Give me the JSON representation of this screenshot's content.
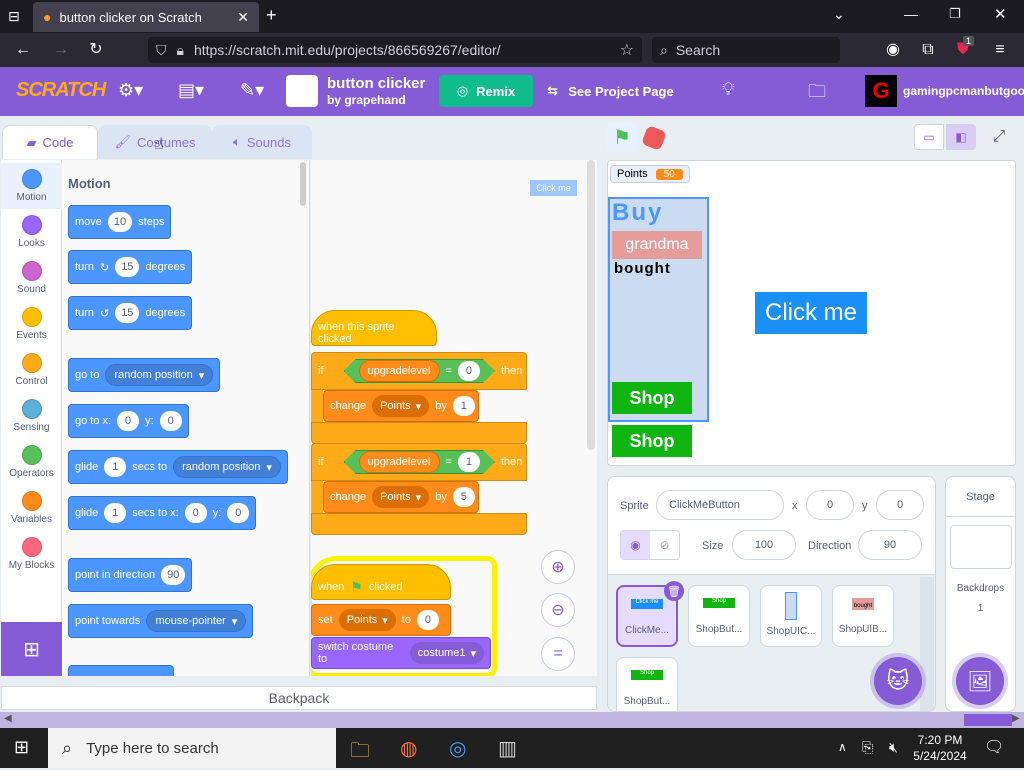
{
  "browser": {
    "tab_title": "button clicker on Scratch",
    "url": "https://scratch.mit.edu/projects/866569267/editor/",
    "search_placeholder": "Search",
    "ext_badge": "1"
  },
  "menubar": {
    "logo_text": "SCRATCH",
    "project_title": "button clicker",
    "author": "by grapehand",
    "remix_label": "Remix",
    "see_project_label": "See Project Page",
    "username": "gamingpcmanbutgoo"
  },
  "editor_tabs": {
    "code": "Code",
    "costumes": "Costumes",
    "sounds": "Sounds"
  },
  "categories": [
    {
      "label": "Motion",
      "color": "#4c97ff"
    },
    {
      "label": "Looks",
      "color": "#9966ff"
    },
    {
      "label": "Sound",
      "color": "#cf63cf"
    },
    {
      "label": "Events",
      "color": "#ffbf00"
    },
    {
      "label": "Control",
      "color": "#ffab19"
    },
    {
      "label": "Sensing",
      "color": "#5cb1d6"
    },
    {
      "label": "Operators",
      "color": "#59c059"
    },
    {
      "label": "Variables",
      "color": "#ff8c1a"
    },
    {
      "label": "My Blocks",
      "color": "#ff6680"
    }
  ],
  "palette": {
    "heading": "Motion",
    "move": {
      "a": "move",
      "v": "10",
      "b": "steps"
    },
    "turn_cw": {
      "a": "turn",
      "v": "15",
      "b": "degrees"
    },
    "turn_ccw": {
      "a": "turn",
      "v": "15",
      "b": "degrees"
    },
    "goto": {
      "a": "go to",
      "v": "random position"
    },
    "gotoxy": {
      "a": "go to x:",
      "x": "0",
      "b": "y:",
      "y": "0"
    },
    "glide": {
      "a": "glide",
      "v": "1",
      "b": "secs to",
      "t": "random position"
    },
    "glidexy": {
      "a": "glide",
      "v": "1",
      "b": "secs to x:",
      "x": "0",
      "c": "y:",
      "y": "0"
    },
    "point": {
      "a": "point in direction",
      "v": "90"
    },
    "towards": {
      "a": "point towards",
      "v": "mouse-pointer"
    }
  },
  "script": {
    "comment_chip": "Click me",
    "hat1": "when this sprite clicked",
    "if1": {
      "a": "if",
      "var": "upgradelevel",
      "op": "=",
      "v": "0",
      "b": "then"
    },
    "change1": {
      "a": "change",
      "var": "Points",
      "b": "by",
      "v": "1"
    },
    "if2": {
      "a": "if",
      "var": "upgradelevel",
      "op": "=",
      "v": "1",
      "b": "then"
    },
    "change2": {
      "a": "change",
      "var": "Points",
      "b": "by",
      "v": "5"
    },
    "hat2": {
      "a": "when",
      "b": "clicked"
    },
    "set": {
      "a": "set",
      "var": "Points",
      "b": "to",
      "v": "0"
    },
    "costume": {
      "a": "switch costume to",
      "v": "costume1"
    }
  },
  "backpack": "Backpack",
  "stage": {
    "monitor_label": "Points",
    "monitor_value": "50",
    "buy_text": "Buy",
    "grandma_text": "grandma",
    "bought_text": "bought",
    "shop1": "Shop",
    "shop2": "Shop",
    "clickme": "Click me"
  },
  "sprite_info": {
    "sprite_label": "Sprite",
    "sprite_name": "ClickMeButton",
    "x_label": "x",
    "x": "0",
    "y_label": "y",
    "y": "0",
    "size_label": "Size",
    "size": "100",
    "direction_label": "Direction",
    "direction": "90"
  },
  "sprites": [
    {
      "name": "ClickMe...",
      "mini": "Click me"
    },
    {
      "name": "ShopBut...",
      "mini": "Shop"
    },
    {
      "name": "ShopUIC...",
      "mini": ""
    },
    {
      "name": "ShopUIB...",
      "mini": "bought"
    },
    {
      "name": "ShopBut...",
      "mini": "Shop"
    }
  ],
  "stage_pane": {
    "title": "Stage",
    "backdrops_label": "Backdrops",
    "backdrops_count": "1"
  },
  "taskbar": {
    "search_placeholder": "Type here to search",
    "time": "7:20 PM",
    "date": "5/24/2024"
  }
}
